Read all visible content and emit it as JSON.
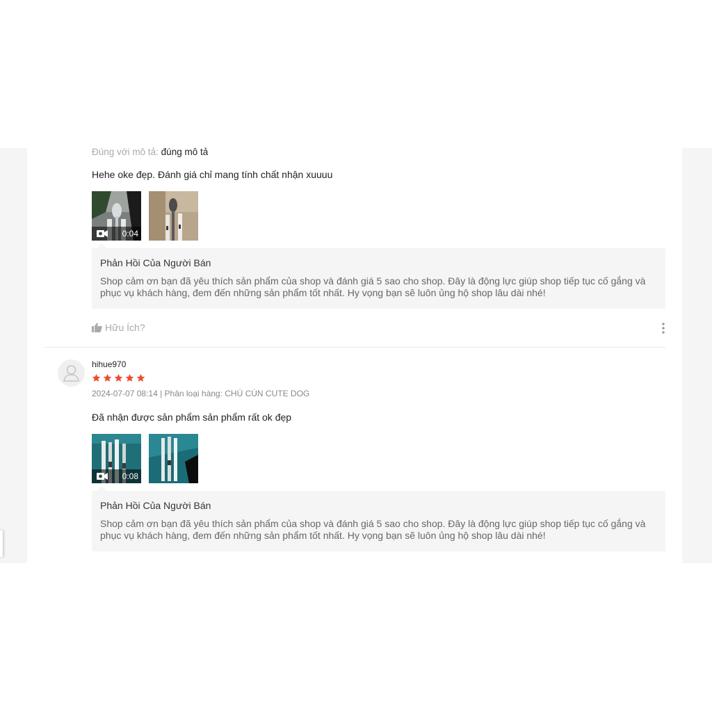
{
  "review1": {
    "desc_key": "Đúng với mô tả:",
    "desc_value": "đúng mô tả",
    "text": "Hehe oke đẹp. Đánh giá chỉ mang tính chất nhận xuuuu",
    "video_duration": "0:04",
    "reply_title": "Phản Hồi Của Người Bán",
    "reply_body_line1": "Shop cảm ơn bạn đã yêu thích sản phẩm của shop và đánh giá 5 sao cho shop. Đây là động lực giúp shop tiếp tục cố gắng và",
    "reply_body_line2": "phục vụ khách hàng, đem đến những sản phẩm tốt nhất. Hy vọng bạn sẽ luôn ủng hộ shop lâu dài nhé!",
    "helpful_label": "Hữu Ích?"
  },
  "review2": {
    "username": "hihue970",
    "rating": 5,
    "meta": "2024-07-07 08:14 | Phân loại hàng: CHÚ CÚN CUTE DOG",
    "text": "Đã nhận được sản phẩm sản phẩm rất ok đẹp",
    "video_duration": "0:08",
    "reply_title": "Phản Hồi Của Người Bán",
    "reply_body_line1": "Shop cảm ơn bạn đã yêu thích sản phẩm của shop và đánh giá 5 sao cho shop. Đây là động lực giúp shop tiếp tục cố gắng và",
    "reply_body_line2": "phục vụ khách hàng, đem đến những sản phẩm tốt nhất. Hy vọng bạn sẽ luôn ủng hộ shop lâu dài nhé!"
  },
  "colors": {
    "star": "#ee4d2d",
    "muted": "#aaaaaa",
    "reply_bg": "#f5f5f5"
  },
  "icons": {
    "video": "video-camera-icon",
    "helpful": "thumbs-up-icon",
    "more": "more-vertical-icon",
    "avatar": "user-placeholder-icon",
    "star": "star-icon"
  }
}
